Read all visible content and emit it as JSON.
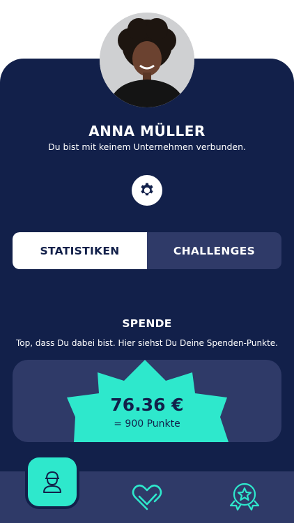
{
  "profile": {
    "name": "ANNA MÜLLER",
    "company_status": "Du bist mit keinem Unternehmen verbunden."
  },
  "tabs": [
    {
      "label": "STATISTIKEN",
      "active": true
    },
    {
      "label": "CHALLENGES",
      "active": false
    }
  ],
  "donation": {
    "title": "SPENDE",
    "description": "Top, dass Du dabei bist. Hier siehst Du Deine Spenden-Punkte.",
    "amount": "76.36 €",
    "points": "= 900 Punkte"
  },
  "navigation": {
    "items": [
      "profile-icon",
      "heart-hands-icon",
      "award-badge-icon"
    ],
    "active": "profile-icon"
  },
  "colors": {
    "navy": "#12204a",
    "slate": "#2f3a68",
    "accent": "#2ee8cc",
    "white": "#ffffff"
  }
}
